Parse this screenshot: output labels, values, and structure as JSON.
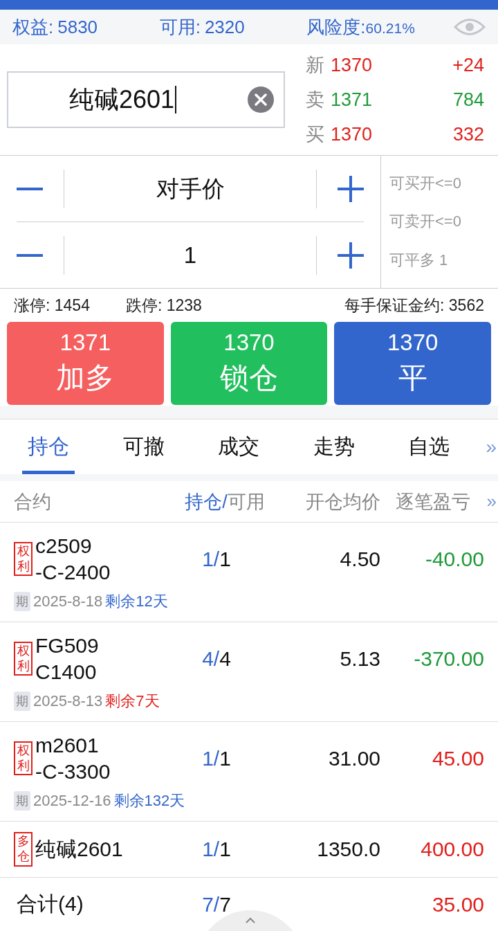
{
  "account": [
    {
      "label": "权益:",
      "value": "5830"
    },
    {
      "label": "可用:",
      "value": "2320"
    },
    {
      "label": "风险度:",
      "value": "60.21%"
    }
  ],
  "search": {
    "value": "纯碱2601"
  },
  "quotes": [
    {
      "label": "新",
      "price": "1370",
      "change": "+24",
      "color": "#e0201c"
    },
    {
      "label": "卖",
      "price": "1371",
      "change": "784",
      "color": "#1f9a3a"
    },
    {
      "label": "买",
      "price": "1370",
      "change": "332",
      "color": "#e0201c"
    }
  ],
  "order": {
    "price_mode": "对手价",
    "quantity": "1",
    "limits": [
      "可买开<=0",
      "可卖开<=0",
      "可平多 1"
    ]
  },
  "info": {
    "limit_up": "涨停: 1454",
    "limit_down": "跌停: 1238",
    "margin": "每手保证金约: 3562"
  },
  "actions": [
    {
      "kind": "buy",
      "price": "1371",
      "label": "加多"
    },
    {
      "kind": "lock",
      "price": "1370",
      "label": "锁仓"
    },
    {
      "kind": "close",
      "price": "1370",
      "label": "平"
    }
  ],
  "tabs": [
    {
      "label": "持仓",
      "selected": true
    },
    {
      "label": "可撤",
      "selected": false
    },
    {
      "label": "成交",
      "selected": false
    },
    {
      "label": "走势",
      "selected": false
    },
    {
      "label": "自选",
      "selected": false
    }
  ],
  "tabs_more": "»",
  "columns": {
    "contract": "合约",
    "held": "持仓/",
    "available": "可用",
    "avg_price": "开仓均价",
    "pnl": "逐笔盈亏",
    "more": "»"
  },
  "rows": [
    {
      "tag": "权利",
      "contract": [
        "c2509",
        "-C-2400"
      ],
      "held": "1/",
      "available": "1",
      "avg_price": "4.50",
      "pnl": "-40.00",
      "color": "#1f9a3a",
      "expiry": {
        "badge": "期",
        "date": "2025-8-18",
        "remaining": "剩余12天",
        "urgent": false
      }
    },
    {
      "tag": "权利",
      "contract": [
        "FG509",
        "C1400"
      ],
      "held": "4/",
      "available": "4",
      "avg_price": "5.13",
      "pnl": "-370.00",
      "color": "#1f9a3a",
      "expiry": {
        "badge": "期",
        "date": "2025-8-13",
        "remaining": "剩余7天",
        "urgent": true
      }
    },
    {
      "tag": "权利",
      "contract": [
        "m2601",
        "-C-3300"
      ],
      "held": "1/",
      "available": "1",
      "avg_price": "31.00",
      "pnl": "45.00",
      "color": "#e0201c",
      "expiry": {
        "badge": "期",
        "date": "2025-12-16",
        "remaining": "剩余132天",
        "urgent": false
      }
    },
    {
      "tag": "多仓",
      "contract": [
        "纯碱2601"
      ],
      "held": "1/",
      "available": "1",
      "avg_price": "1350.0",
      "pnl": "400.00",
      "color": "#e0201c"
    }
  ],
  "total": {
    "label": "合计(4)",
    "held": "7/",
    "available": "7",
    "pnl": "35.00",
    "color": "#e0201c"
  }
}
